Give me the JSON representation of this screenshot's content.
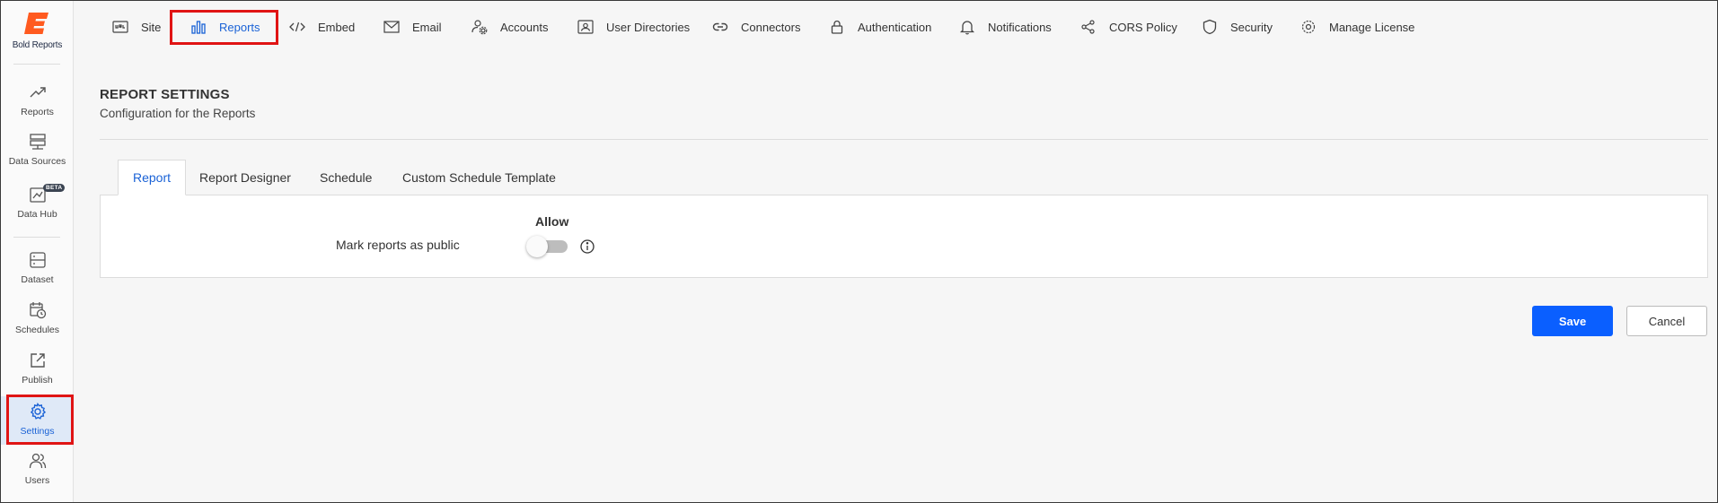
{
  "brand": {
    "name": "Bold Reports",
    "color": "#ff5a1f"
  },
  "sidebar": {
    "items": [
      {
        "label": "Reports",
        "icon": "trend-icon"
      },
      {
        "label": "Data Sources",
        "icon": "server-icon"
      },
      {
        "label": "Data Hub",
        "icon": "datahub-icon",
        "badge": "BETA"
      },
      {
        "label": "Dataset",
        "icon": "dataset-icon"
      },
      {
        "label": "Schedules",
        "icon": "calendar-clock-icon"
      },
      {
        "label": "Publish",
        "icon": "publish-icon"
      },
      {
        "label": "Settings",
        "icon": "gear-icon",
        "active": true
      },
      {
        "label": "Users",
        "icon": "users-icon"
      }
    ]
  },
  "topnav": {
    "tabs": [
      {
        "label": "Site",
        "icon": "url-icon"
      },
      {
        "label": "Reports",
        "icon": "bar-chart-icon",
        "active": true
      },
      {
        "label": "Embed",
        "icon": "code-icon"
      },
      {
        "label": "Email",
        "icon": "mail-icon"
      },
      {
        "label": "Accounts",
        "icon": "account-gear-icon"
      },
      {
        "label": "User Directories",
        "icon": "id-card-icon"
      },
      {
        "label": "Connectors",
        "icon": "link-icon"
      },
      {
        "label": "Authentication",
        "icon": "lock-icon"
      },
      {
        "label": "Notifications",
        "icon": "bell-icon"
      },
      {
        "label": "CORS Policy",
        "icon": "share-icon"
      },
      {
        "label": "Security",
        "icon": "shield-icon"
      },
      {
        "label": "Manage License",
        "icon": "license-gear-icon"
      }
    ]
  },
  "page": {
    "title": "REPORT SETTINGS",
    "subtitle": "Configuration for the Reports"
  },
  "subtabs": [
    {
      "label": "Report",
      "active": true
    },
    {
      "label": "Report Designer"
    },
    {
      "label": "Schedule"
    },
    {
      "label": "Custom Schedule Template"
    }
  ],
  "settings": {
    "column_header": "Allow",
    "rows": [
      {
        "label": "Mark reports as public",
        "enabled": false
      }
    ]
  },
  "actions": {
    "save": "Save",
    "cancel": "Cancel"
  },
  "colors": {
    "accent": "#1a62d6",
    "primary_button": "#0a5fff",
    "highlight": "#e01414"
  }
}
